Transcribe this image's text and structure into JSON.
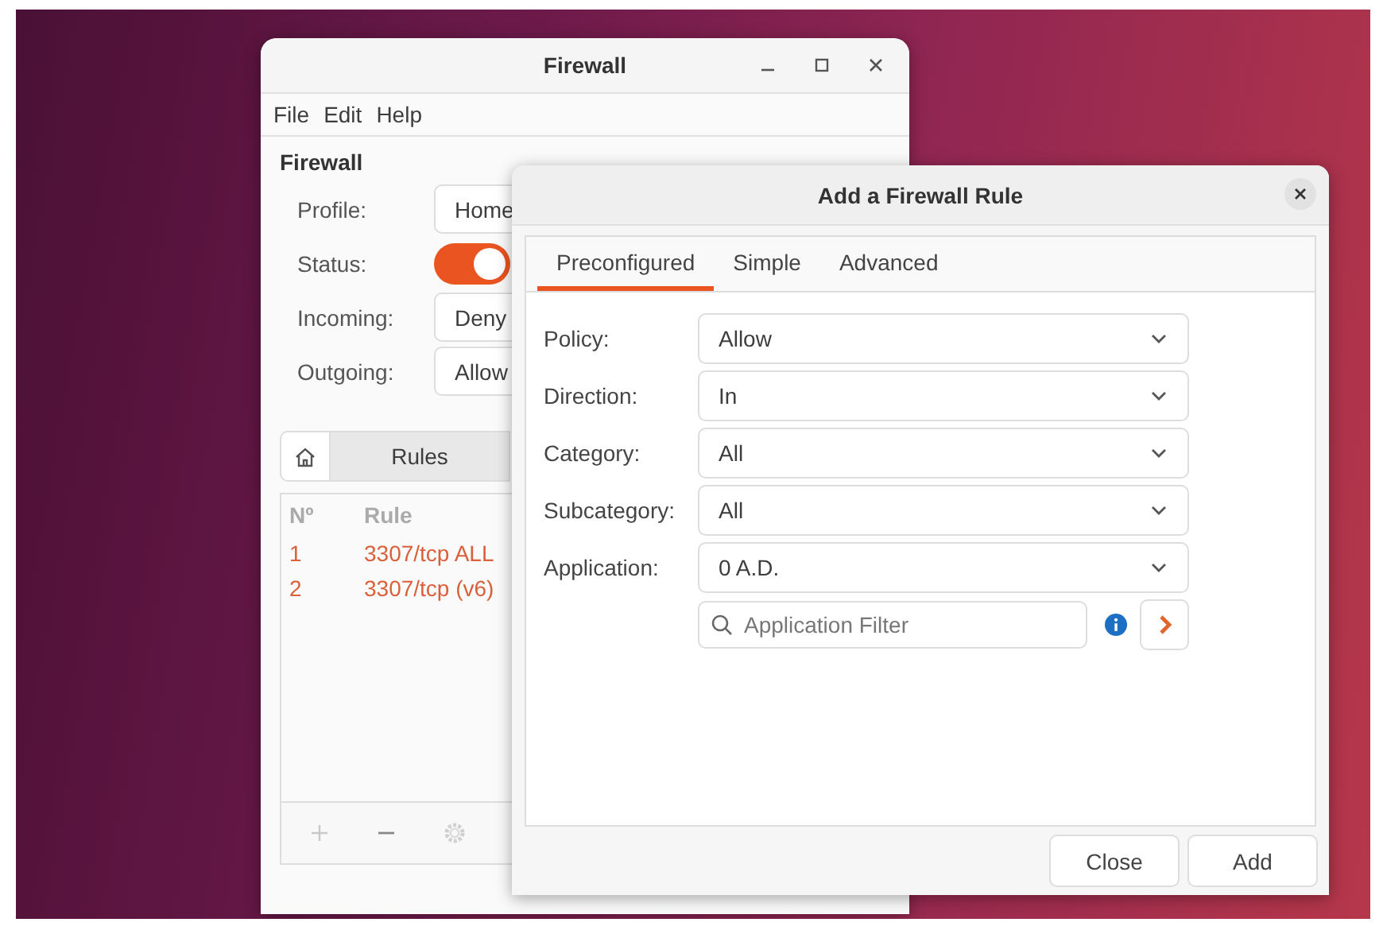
{
  "main_window": {
    "title": "Firewall",
    "menu": [
      "File",
      "Edit",
      "Help"
    ],
    "heading": "Firewall",
    "fields": [
      {
        "kind": "combo",
        "label": "Profile:",
        "value": "Home"
      },
      {
        "kind": "switch",
        "label": "Status:",
        "on": true
      },
      {
        "kind": "combo",
        "label": "Incoming:",
        "value": "Deny"
      },
      {
        "kind": "combo",
        "label": "Outgoing:",
        "value": "Allow"
      }
    ],
    "tabs": [
      {
        "kind": "home",
        "selected": false
      },
      {
        "kind": "text",
        "label": "Rules",
        "selected": true
      }
    ],
    "rules": {
      "columns": [
        "Nº",
        "Rule"
      ],
      "rows": [
        {
          "number": "1",
          "rule": "3307/tcp ALL"
        },
        {
          "number": "2",
          "rule": "3307/tcp (v6)"
        }
      ]
    }
  },
  "dialog": {
    "title": "Add a Firewall Rule",
    "tabs": [
      {
        "label": "Preconfigured",
        "selected": true
      },
      {
        "label": "Simple",
        "selected": false
      },
      {
        "label": "Advanced",
        "selected": false
      }
    ],
    "fields": [
      {
        "label": "Policy:",
        "value": "Allow"
      },
      {
        "label": "Direction:",
        "value": "In"
      },
      {
        "label": "Category:",
        "value": "All"
      },
      {
        "label": "Subcategory:",
        "value": "All"
      },
      {
        "label": "Application:",
        "value": "0 A.D."
      }
    ],
    "filter": {
      "placeholder": "Application Filter"
    },
    "buttons": [
      "Close",
      "Add"
    ]
  }
}
